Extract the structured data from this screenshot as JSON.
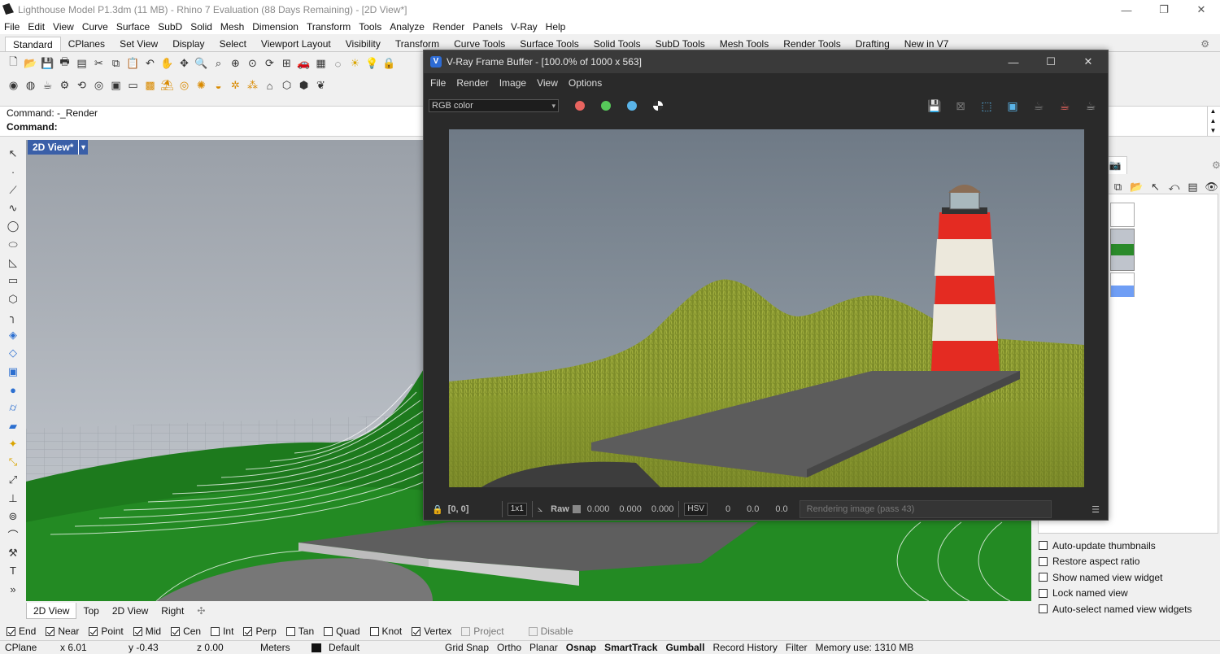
{
  "window": {
    "title": "Lighthouse Model P1.3dm (11 MB) - Rhino 7 Evaluation (88 Days Remaining) - [2D View*]"
  },
  "menu": [
    "File",
    "Edit",
    "View",
    "Curve",
    "Surface",
    "SubD",
    "Solid",
    "Mesh",
    "Dimension",
    "Transform",
    "Tools",
    "Analyze",
    "Render",
    "Panels",
    "V-Ray",
    "Help"
  ],
  "tabs": [
    "Standard",
    "CPlanes",
    "Set View",
    "Display",
    "Select",
    "Viewport Layout",
    "Visibility",
    "Transform",
    "Curve Tools",
    "Surface Tools",
    "Solid Tools",
    "SubD Tools",
    "Mesh Tools",
    "Render Tools",
    "Drafting",
    "New in V7"
  ],
  "command": {
    "history": "Command: -_Render",
    "prompt": "Command:"
  },
  "viewport": {
    "active_tab": "2D View*",
    "tabs": [
      "2D View",
      "Top",
      "2D View",
      "Right"
    ]
  },
  "right_panel": {
    "options": [
      {
        "label": "Auto-update thumbnails",
        "checked": false
      },
      {
        "label": "Restore aspect ratio",
        "checked": false
      },
      {
        "label": "Show named view widget",
        "checked": false
      },
      {
        "label": "Lock named view",
        "checked": false
      },
      {
        "label": "Auto-select named view widgets",
        "checked": false
      }
    ]
  },
  "osnap": [
    {
      "label": "End",
      "checked": true
    },
    {
      "label": "Near",
      "checked": true
    },
    {
      "label": "Point",
      "checked": true
    },
    {
      "label": "Mid",
      "checked": true
    },
    {
      "label": "Cen",
      "checked": true
    },
    {
      "label": "Int",
      "checked": false
    },
    {
      "label": "Perp",
      "checked": true
    },
    {
      "label": "Tan",
      "checked": false
    },
    {
      "label": "Quad",
      "checked": false
    },
    {
      "label": "Knot",
      "checked": false
    },
    {
      "label": "Vertex",
      "checked": true
    },
    {
      "label": "Project",
      "checked": false,
      "disabled": true
    },
    {
      "label": "Disable",
      "checked": false,
      "disabled": true
    }
  ],
  "status": {
    "cplane": "CPlane",
    "x": "x 6.01",
    "y": "y -0.43",
    "z": "z 0.00",
    "units": "Meters",
    "layer": "Default",
    "grid_snap": "Grid Snap",
    "ortho": "Ortho",
    "planar": "Planar",
    "osnap": "Osnap",
    "smarttrack": "SmartTrack",
    "gumball": "Gumball",
    "record_history": "Record History",
    "filter": "Filter",
    "memory": "Memory use: 1310 MB"
  },
  "vfb": {
    "title": "V-Ray Frame Buffer - [100.0% of 1000 x 563]",
    "menu": [
      "File",
      "Render",
      "Image",
      "View",
      "Options"
    ],
    "channel": "RGB color",
    "colors": {
      "red": "#e8645f",
      "green": "#57c95a",
      "blue": "#5ab4e8"
    },
    "coords": "[0, 0]",
    "zoom": "1x1",
    "raw": "Raw",
    "rgb_values": [
      "0.000",
      "0.000",
      "0.000"
    ],
    "color_mode": "HSV",
    "hsv_values": [
      "0",
      "0.0",
      "0.0"
    ],
    "progress": "Rendering image (pass 43)"
  },
  "icons": {
    "toolbar_row1": [
      "new-file-icon",
      "open-icon",
      "save-icon",
      "print-icon",
      "import-icon",
      "cut-icon",
      "copy-icon",
      "paste-icon",
      "undo-icon",
      "pan-icon",
      "move-icon",
      "zoom-icon",
      "zoom-window-icon",
      "zoom-extents-icon",
      "zoom-selected-icon",
      "rotate-icon",
      "four-view-icon",
      "car-icon",
      "grid-icon",
      "point-icon",
      "sun-icon",
      "light-icon",
      "lock-icon"
    ],
    "toolbar_row2": [
      "snapshot-icon",
      "material-icon",
      "teapot-icon",
      "render-icon",
      "render-window-icon",
      "environment-icon",
      "texture-icon",
      "ground-icon",
      "layer-icon",
      "lamp-icon",
      "target-icon",
      "sun-icon",
      "sphere-icon",
      "settings-icon",
      "dots-icon",
      "camera-icon",
      "cube-icon",
      "box-icon",
      "plant-icon"
    ]
  }
}
